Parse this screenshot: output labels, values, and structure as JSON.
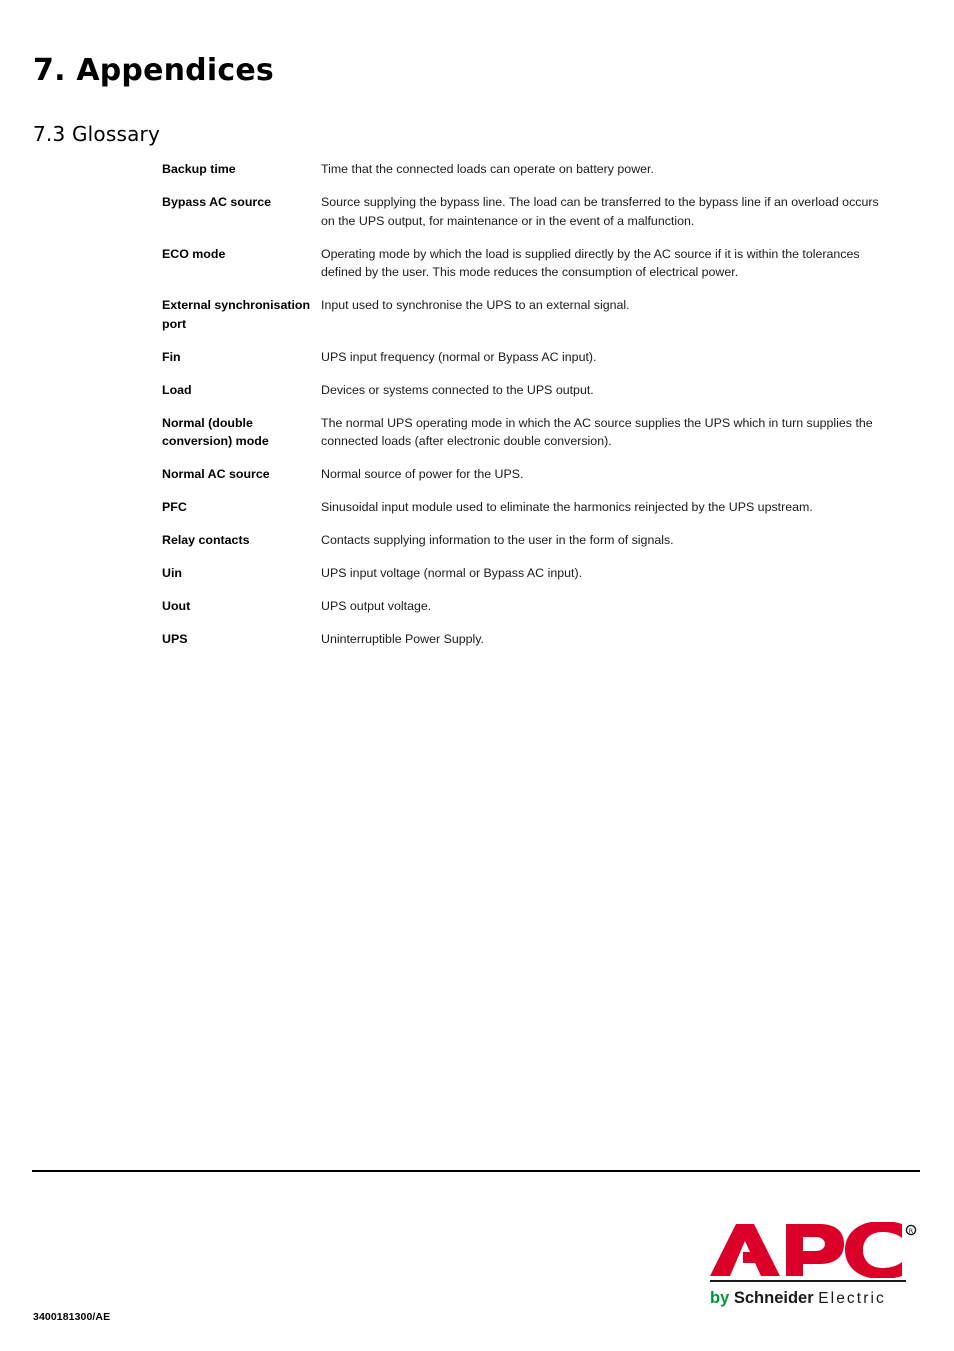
{
  "document": {
    "chapter_title": "7. Appendices",
    "section_title": "7.3 Glossary",
    "doc_number": "3400181300/AE"
  },
  "glossary": {
    "entries": [
      {
        "term": "Backup time",
        "definition": "Time that the connected loads can operate on battery power."
      },
      {
        "term": "Bypass AC source",
        "definition": "Source supplying the bypass line. The load can be transferred to the bypass line if an overload occurs on the UPS output, for maintenance or in the event of a malfunction."
      },
      {
        "term": "ECO mode",
        "definition": "Operating mode by which the load is supplied directly by the AC source if it is within the tolerances defined by the user. This mode reduces the consumption of electrical power."
      },
      {
        "term": "External synchronisation port",
        "definition": "Input used to synchronise the UPS to an external signal."
      },
      {
        "term": "Fin",
        "definition": "UPS input frequency (normal or Bypass AC input)."
      },
      {
        "term": "Load",
        "definition": "Devices or systems connected to the UPS output."
      },
      {
        "term": "Normal (double conversion) mode",
        "definition": "The normal UPS operating mode in which the AC source supplies the UPS which in turn supplies the connected loads (after electronic double conversion)."
      },
      {
        "term": "Normal AC source",
        "definition": "Normal source of power for the UPS."
      },
      {
        "term": "PFC",
        "definition": "Sinusoidal input module used to eliminate the harmonics reinjected by the UPS upstream."
      },
      {
        "term": "Relay contacts",
        "definition": "Contacts supplying information to the user in the form of signals."
      },
      {
        "term": "Uin",
        "definition": "UPS input voltage (normal or Bypass AC input)."
      },
      {
        "term": "Uout",
        "definition": "UPS output voltage."
      },
      {
        "term": "UPS",
        "definition": "Uninterruptible Power Supply."
      }
    ]
  },
  "logo": {
    "wordmark": "APC",
    "registered_mark": "®",
    "tagline_by": "by",
    "tagline_schneider": "Schneider",
    "tagline_electric": "Electric",
    "colors": {
      "apc_red": "#DB0028",
      "by_green": "#009639",
      "text_black": "#1A1A1A"
    }
  }
}
